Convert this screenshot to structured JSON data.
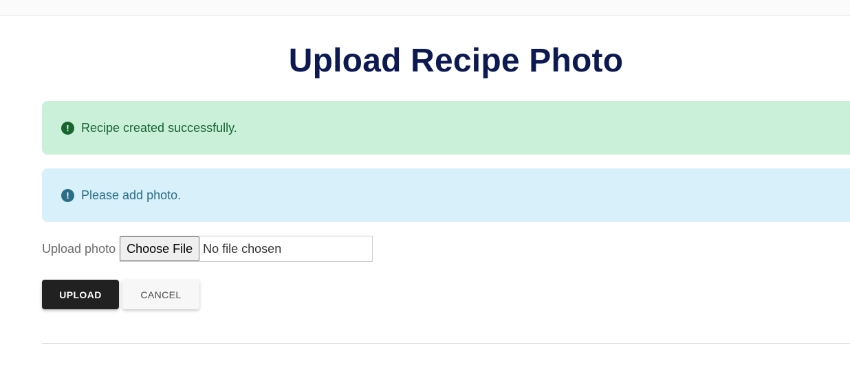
{
  "page": {
    "title": "Upload Recipe Photo"
  },
  "alerts": {
    "success": {
      "icon": "exclamation-circle-icon",
      "text": "Recipe created successfully.",
      "color": "#17652f",
      "background": "#cbf0da"
    },
    "info": {
      "icon": "exclamation-circle-icon",
      "text": "Please add photo.",
      "color": "#2a6d86",
      "background": "#d7f0f9"
    }
  },
  "form": {
    "upload_label": "Upload photo",
    "choose_file_label": "Choose File",
    "file_status": "No file chosen"
  },
  "actions": {
    "upload_label": "UPLOAD",
    "cancel_label": "CANCEL"
  },
  "colors": {
    "title": "#0d1a52",
    "primary_button": "#212121"
  }
}
